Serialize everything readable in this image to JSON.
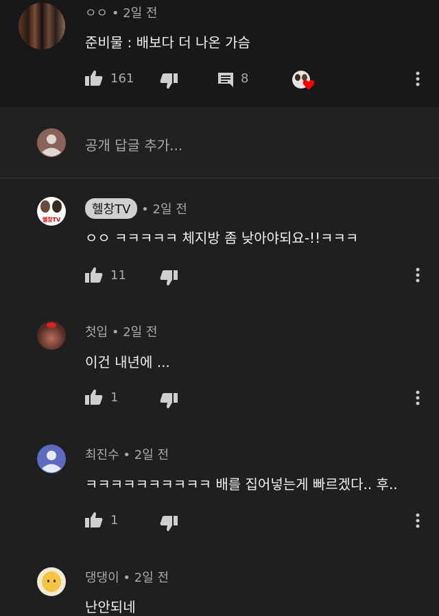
{
  "main_comment": {
    "author": "ㅇㅇ",
    "time": "2일 전",
    "text": "준비물 : 배보다 더 나온 가슴",
    "likes": "161",
    "replies": "8"
  },
  "reply_box": {
    "placeholder": "공개 답글 추가..."
  },
  "replies": [
    {
      "author": "헬창TV",
      "time": "2일 전",
      "text": "ㅇㅇ ㅋㅋㅋㅋㅋ 체지방 좀 낮아야되요-!!ㅋㅋㅋ",
      "likes": "11",
      "avatar_text": "헬창TV"
    },
    {
      "author": "첫입",
      "time": "2일 전",
      "text": "이건 내년에 ...",
      "likes": "1"
    },
    {
      "author": "최진수",
      "time": "2일 전",
      "text": "ㅋㅋㅋㅋㅋㅋㅋㅋㅋㅋ 배를 집어넣는게 빠르겠다.. 후..",
      "likes": "1"
    },
    {
      "author": "댕댕이",
      "time": "2일 전",
      "text": "난안되네"
    }
  ],
  "colors": {
    "heart": "#ff0000",
    "badge_bg": "#d0d0d0"
  }
}
